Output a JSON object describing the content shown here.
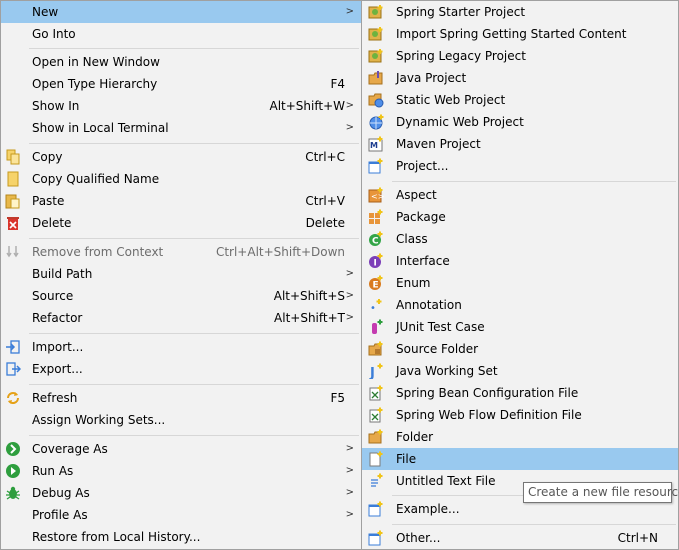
{
  "context_menu": {
    "new": "New",
    "go_into": "Go Into",
    "open_new_window": "Open in New Window",
    "open_type_hierarchy": "Open Type Hierarchy",
    "open_type_hierarchy_key": "F4",
    "show_in": "Show In",
    "show_in_key": "Alt+Shift+W",
    "show_local_terminal": "Show in Local Terminal",
    "copy": "Copy",
    "copy_key": "Ctrl+C",
    "copy_qualified": "Copy Qualified Name",
    "paste": "Paste",
    "paste_key": "Ctrl+V",
    "delete": "Delete",
    "delete_key": "Delete",
    "remove_context": "Remove from Context",
    "remove_context_key": "Ctrl+Alt+Shift+Down",
    "build_path": "Build Path",
    "source": "Source",
    "source_key": "Alt+Shift+S",
    "refactor": "Refactor",
    "refactor_key": "Alt+Shift+T",
    "import": "Import...",
    "export": "Export...",
    "refresh": "Refresh",
    "refresh_key": "F5",
    "assign_working_sets": "Assign Working Sets...",
    "coverage_as": "Coverage As",
    "run_as": "Run As",
    "debug_as": "Debug As",
    "profile_as": "Profile As",
    "restore_history": "Restore from Local History..."
  },
  "new_submenu": {
    "spring_starter": "Spring Starter Project",
    "spring_getting_started": "Import Spring Getting Started Content",
    "spring_legacy": "Spring Legacy Project",
    "java_project": "Java Project",
    "static_web": "Static Web Project",
    "dynamic_web": "Dynamic Web Project",
    "maven_project": "Maven Project",
    "project": "Project...",
    "aspect": "Aspect",
    "package": "Package",
    "class": "Class",
    "interface": "Interface",
    "enum": "Enum",
    "annotation": "Annotation",
    "junit": "JUnit Test Case",
    "source_folder": "Source Folder",
    "java_working_set": "Java Working Set",
    "spring_bean": "Spring Bean Configuration File",
    "spring_webflow": "Spring Web Flow Definition File",
    "folder": "Folder",
    "file": "File",
    "untitled_text": "Untitled Text File",
    "example": "Example...",
    "other": "Other...",
    "other_key": "Ctrl+N"
  },
  "tooltip": "Create a new file resource",
  "colors": {
    "menu_bg": "#f2f2f2",
    "selection": "#99c9ef",
    "separator": "#d7d7d7",
    "disabled_text": "#6d6d6d"
  }
}
